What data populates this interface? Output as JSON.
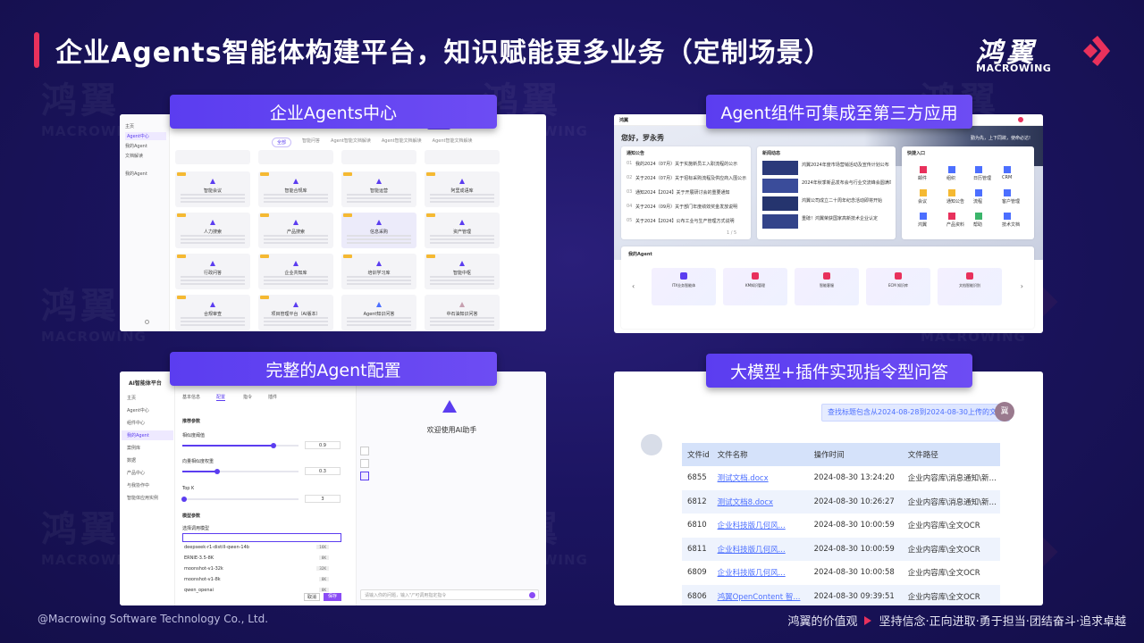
{
  "slide": {
    "title": "企业Agents智能体构建平台，知识赋能更多业务（定制场景）",
    "logo_cn": "鸿翼",
    "logo_en": "MACROWING",
    "footer_left": "@Macrowing Software Technology Co., Ltd.",
    "footer_right_label": "鸿翼的价值观",
    "footer_right_values": "坚持信念·正向进取·勇于担当·团结奋斗·追求卓越"
  },
  "tags": {
    "p1": "企业Agents中心",
    "p2": "Agent组件可集成至第三方应用",
    "p3": "完整的Agent配置",
    "p4": "大模型+插件实现指令型问答"
  },
  "panel1": {
    "side": [
      "主页",
      "Agent中心",
      "我的Agent",
      "文档解读",
      "我的Agent"
    ],
    "tabs": [
      "全部",
      "智能问答",
      "Agent智能文档解读",
      "Agent智能文档解读",
      "Agent智能文档解读"
    ],
    "hot": "HOT",
    "cards": [
      "智能会议",
      "智能合规库",
      "智能运营",
      "阿里成语库",
      "人力搜索",
      "产品搜索",
      "信息采购",
      "资产管理",
      "行政问答",
      "企业共知库",
      "培训学习库",
      "智能中枢",
      "合规审查",
      "项目管理平台（AI版本）",
      "Agent知识问答",
      "中石油知识问答"
    ]
  },
  "panel2": {
    "greeting": "您好，罗永秀",
    "slogan": "勤为先，上下同欲，使命必达!",
    "notice_title": "通知公告",
    "news_title": "新闻动态",
    "quick_title": "快捷入口",
    "agents_title": "我的Agent",
    "notices": [
      "我的2024（07月）关于实施新员工入职流程的公示",
      "关于2024（07月）关于招标采购流程及供应商入围公示",
      "通知2024【2024】关于开展研讨会的重要通知",
      "关于2024（09月）关于部门年度绩效奖金发放说明",
      "关于2024【2024】公布工业与生产管理方式说明"
    ],
    "news": [
      "鸿翼2024年度市场营销活动及宣传计划公布",
      "2024年秋季新品发布会与行业交流峰会圆满举办",
      "鸿翼公司成立二十周年纪念活动即将开始",
      "重磅！鸿翼荣获国家高新技术企业认定"
    ],
    "quick": [
      "邮件",
      "组织",
      "日历管理",
      "CRM",
      "会议",
      "通知公告",
      "流程",
      "客户管理",
      "鸿翼",
      "产品资料",
      "帮助",
      "技术文档"
    ],
    "agents": [
      "ITX业务智能体",
      "KM知识管理",
      "智能客服",
      "ECM 知识库",
      "文档智能识别"
    ],
    "pager": "1 / 5"
  },
  "panel3": {
    "app_name": "AI智能体平台",
    "side": [
      "主页",
      "Agent中心",
      "组件中心",
      "我的Agent",
      "案例库",
      "数据",
      "产品中心",
      "与我协作中",
      "智能体应用实例"
    ],
    "tabs": [
      "基本信息",
      "配置",
      "指令",
      "插件"
    ],
    "section1": "推荐参数",
    "params": [
      {
        "label": "相似度阈值",
        "value": "0.9",
        "fill": 0.78
      },
      {
        "label": "向量相似度权重",
        "value": "0.3",
        "fill": 0.3
      },
      {
        "label": "Top K",
        "value": "3",
        "fill": 0.0
      }
    ],
    "section2": "模型参数",
    "model_label": "选择调用模型",
    "models": [
      {
        "name": "deepseek-r1-distill-qwen-14b",
        "badge": "16K"
      },
      {
        "name": "ERNIE-3.5-8K",
        "badge": "8K"
      },
      {
        "name": "moonshot-v1-32k",
        "badge": "32K"
      },
      {
        "name": "moonshot-v1-8k",
        "badge": "8K"
      },
      {
        "name": "qwen_openai",
        "badge": "8K"
      }
    ],
    "welcome": "欢迎使用AI助手",
    "chat_placeholder": "请输入你的问题，输入\"/\"可调用指定指令",
    "cancel": "取消",
    "save": "保存"
  },
  "panel4": {
    "question": "查找标题包含从2024-08-28到2024-08-30上传的文件",
    "user_avatar": "冀",
    "columns": [
      "文件id",
      "文件名称",
      "操作时间",
      "文件路径"
    ],
    "rows": [
      [
        "6855",
        "测试文档.docx",
        "2024-08-30 13:24:20",
        "企业内容库\\消息通知\\新增文件（..."
      ],
      [
        "6812",
        "测试文档8.docx",
        "2024-08-30 10:26:27",
        "企业内容库\\消息通知\\新增文件（..."
      ],
      [
        "6810",
        "企业科技版几何风...",
        "2024-08-30 10:00:59",
        "企业内容库\\全文OCR"
      ],
      [
        "6811",
        "企业科技版几何风...",
        "2024-08-30 10:00:59",
        "企业内容库\\全文OCR"
      ],
      [
        "6809",
        "企业科技版几何风...",
        "2024-08-30 10:00:58",
        "企业内容库\\全文OCR"
      ],
      [
        "6806",
        "鸿翼OpenContent 智...",
        "2024-08-30 09:39:51",
        "企业内容库\\全文OCR"
      ]
    ]
  },
  "colors": {
    "accent": "#5b3df0",
    "brand_red": "#e8315c",
    "bg": "#1b1460"
  }
}
